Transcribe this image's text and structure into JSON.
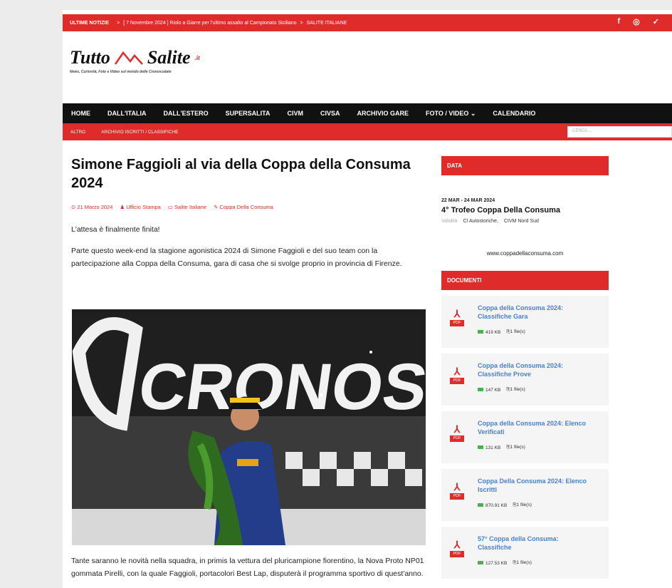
{
  "topbar": {
    "ticker_label": "ULTIME NOTIZIE",
    "ticker_arrow": ">",
    "ticker_text": "[ 7 Novembre 2024 ]  Riolo a Giarre per l'ultimo assalto al Campionato Siciliano",
    "ticker_category": "SALITE ITALIANE",
    "social": [
      "f",
      "◎",
      "✓"
    ]
  },
  "logo": {
    "part1": "Tutto",
    "part2": "Salite",
    "suffix": ".it",
    "tagline": "News, Curiosità, Foto e Video sul mondo delle Cronoscalate"
  },
  "mainnav": [
    "HOME",
    "DALL'ITALIA",
    "DALL'ESTERO",
    "SUPERSALITA",
    "CIVM",
    "CIVSA",
    "ARCHIVIO GARE",
    "FOTO / VIDEO ⌄",
    "CALENDARIO"
  ],
  "subnav": {
    "items": [
      "ALTRO",
      "ARCHIVIO ISCRITTI / CLASSIFICHE"
    ],
    "search_placeholder": "CERCA ..."
  },
  "article": {
    "title": "Simone Faggioli al via della Coppa della Consuma 2024",
    "date": "⊙ 21 Marzo 2024",
    "author": "♟ Ufficio Stampa",
    "category": "▭ Salite Italiane",
    "tag": "✎ Coppa Della Consuma",
    "p1": "L'attesa è finalmente finita!",
    "p2": "Parte questo week-end la stagione agonistica 2024 di Simone Faggioli e del suo team con la partecipazione alla Coppa della Consuma, gara di casa che si svolge proprio in provincia di Firenze.",
    "photo_caption_text": "CRONOSCA",
    "p3": "Tante saranno le novità nella squadra, in primis la vettura del pluricampione fiorentino, la Nova Proto NP01 gommata Pirelli, con la quale Faggioli, portacolori Best Lap, disputerà il programma sportivo di quest'anno."
  },
  "sidebar": {
    "data_heading": "DATA",
    "event_date": "22 MAR - 24 MAR 2024",
    "event_name": "4° Trofeo Coppa Della Consuma",
    "event_tag_label": "Validità",
    "event_tags": [
      "CI Autostoriche,",
      "CIVM Nord Sud"
    ],
    "website": "www.coppadellaconsuma.com",
    "docs_heading": "DOCUMENTI",
    "docs": [
      {
        "title": "Coppa della Consuma 2024: Classifiche Gara",
        "size": "419 KB",
        "files": "⎘1 file(s)"
      },
      {
        "title": "Coppa della Consuma 2024: Classifiche Prove",
        "size": "147 KB",
        "files": "⎘1 file(s)"
      },
      {
        "title": "Coppa della Consuma 2024: Elenco Verificati",
        "size": "131 KB",
        "files": "⎘1 file(s)"
      },
      {
        "title": "Coppa Della Consuma 2024: Elenco Iscritti",
        "size": "870.91 KB",
        "files": "⎘1 file(s)"
      },
      {
        "title": "57° Coppa della Consuma: Classifiche",
        "size": "127.53 KB",
        "files": "⎘1 file(s)"
      }
    ],
    "pdf_label": "PDF"
  },
  "colors": {
    "accent": "#e02b2b",
    "nav": "#111111",
    "link": "#4a7fd0"
  }
}
